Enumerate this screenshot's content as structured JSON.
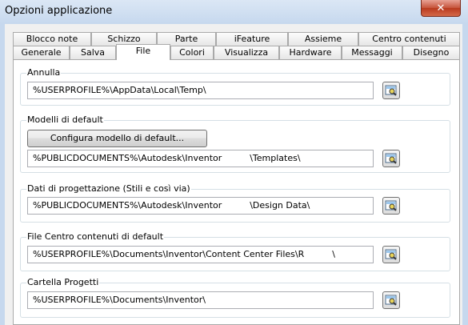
{
  "window": {
    "title": "Opzioni applicazione",
    "close_label": "✕"
  },
  "tabs": {
    "row_back": [
      "Blocco note",
      "Schizzo",
      "Parte",
      "iFeature",
      "Assieme",
      "Centro contenuti"
    ],
    "row_front": [
      "Generale",
      "Salva",
      "File",
      "Colori",
      "Visualizza",
      "Hardware",
      "Messaggi",
      "Disegno"
    ],
    "active": "File"
  },
  "groups": {
    "annulla": {
      "label": "Annulla",
      "path": "%USERPROFILE%\\AppData\\Local\\Temp\\"
    },
    "modelli": {
      "label": "Modelli di default",
      "button_label": "Configura modello di default...",
      "path": "%PUBLICDOCUMENTS%\\Autodesk\\Inventor          \\Templates\\"
    },
    "dati": {
      "label": "Dati di progettazione (Stili e così via)",
      "path": "%PUBLICDOCUMENTS%\\Autodesk\\Inventor          \\Design Data\\"
    },
    "centro": {
      "label": "File Centro contenuti di default",
      "path": "%USERPROFILE%\\Documents\\Inventor\\Content Center Files\\R          \\"
    },
    "progetti": {
      "label": "Cartella Progetti",
      "path": "%USERPROFILE%\\Documents\\Inventor\\"
    }
  },
  "icons": {
    "browse": "browse-folder-icon",
    "close": "close-icon"
  },
  "colors": {
    "titlebar": "#c6d8ee",
    "close": "#c5533a",
    "panel": "#ffffff"
  }
}
